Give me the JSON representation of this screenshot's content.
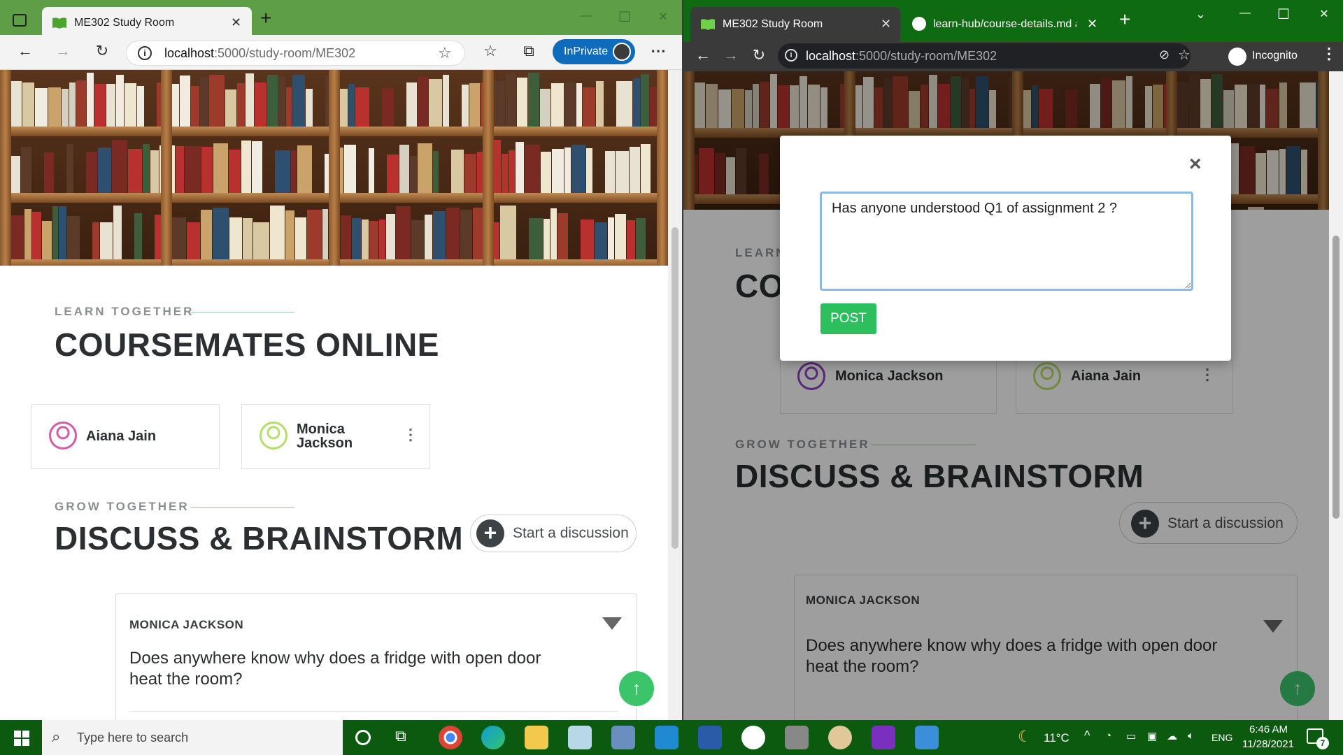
{
  "edge": {
    "tab_title": "ME302 Study Room",
    "new_tab": "+",
    "url_host": "localhost",
    "url_path": ":5000/study-room/ME302",
    "inprivate_label": "InPrivate",
    "win_min": "—",
    "win_max": "☐",
    "win_close": "✕"
  },
  "chrome": {
    "tab1_title": "ME302 Study Room",
    "tab2_title": "learn-hub/course-details.md at m",
    "new_tab": "+",
    "url_host": "localhost",
    "url_path": ":5000/study-room/ME302",
    "incognito_label": "Incognito",
    "win_min": "—",
    "win_max": "☐",
    "win_close": "✕"
  },
  "page": {
    "learn_eyebrow": "LEARN TOGETHER",
    "coursemates_title": "COURSEMATES ONLINE",
    "grow_eyebrow": "GROW TOGETHER",
    "discuss_title": "DISCUSS & BRAINSTORM",
    "start_discussion": "Start a discussion",
    "left_mates": [
      {
        "first": "Aiana Jain",
        "last": ""
      },
      {
        "first": "Monica",
        "last": "Jackson"
      }
    ],
    "right_mates": [
      "Monica Jackson",
      "Aiana Jain"
    ],
    "post": {
      "author": "MONICA JACKSON",
      "text_line1": "Does anywhere know why does a fridge with open door",
      "text_line2": "heat the room?"
    },
    "eyebrow_learn_short": "LEARN",
    "title_short": "CO"
  },
  "modal": {
    "textarea_value": "Has anyone understood Q1 of assignment 2 ?",
    "post_button": "POST",
    "close": "×"
  },
  "taskbar": {
    "search_placeholder": "Type here to search",
    "temperature": "11°C",
    "language": "ENG",
    "time": "6:46 AM",
    "date": "11/28/2021",
    "notification_count": "7"
  },
  "colors": {
    "edge_tabstrip": "#5e9e47",
    "chrome_tabstrip": "#0f6b12",
    "accent_green": "#2dbe5d",
    "inprivate_blue": "#0f6cbd"
  }
}
